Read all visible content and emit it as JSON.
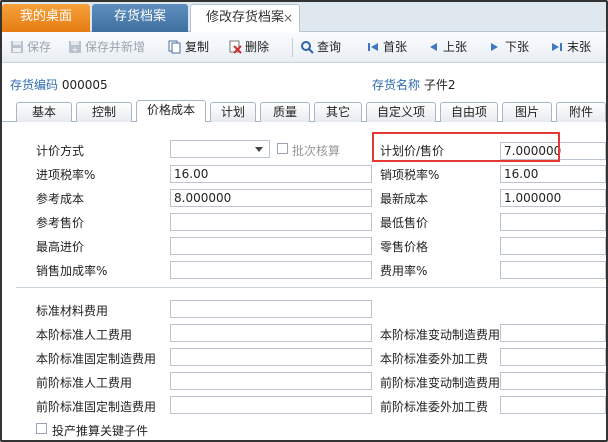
{
  "window_tabs": {
    "home": "我的桌面",
    "inventory": "存货档案",
    "edit": "修改存货档案",
    "close": "×"
  },
  "toolbar": {
    "save": "保存",
    "save_new": "保存并新增",
    "copy": "复制",
    "delete": "删除",
    "query": "查询",
    "first": "首张",
    "prev": "上张",
    "next": "下张",
    "last": "末张"
  },
  "header": {
    "code_label": "存货编码",
    "code_value": "000005",
    "name_label": "存货名称",
    "name_value": "子件2"
  },
  "tabs": [
    "基本",
    "控制",
    "价格成本",
    "计划",
    "质量",
    "其它",
    "自定义项",
    "自由项",
    "图片",
    "附件"
  ],
  "form": {
    "pricing_method_label": "计价方式",
    "pricing_method_value": "",
    "batch_check_label": "批次核算",
    "plan_price_label": "计划价/售价",
    "plan_price_value": "7.000000",
    "input_tax_label": "进项税率%",
    "input_tax_value": "16.00",
    "output_tax_label": "销项税率%",
    "output_tax_value": "16.00",
    "ref_cost_label": "参考成本",
    "ref_cost_value": "8.000000",
    "latest_cost_label": "最新成本",
    "latest_cost_value": "1.000000",
    "ref_price_label": "参考售价",
    "min_price_label": "最低售价",
    "max_purchase_label": "最高进价",
    "retail_price_label": "零售价格",
    "sales_markup_label": "销售加成率%",
    "expense_rate_label": "费用率%",
    "std_material_label": "标准材料费用",
    "this_labor_label": "本阶标准人工费用",
    "this_var_mfg_label": "本阶标准变动制造费用",
    "this_fixed_mfg_label": "本阶标准固定制造费用",
    "this_outsource_label": "本阶标准委外加工费",
    "prev_labor_label": "前阶标准人工费用",
    "prev_var_mfg_label": "前阶标准变动制造费用",
    "prev_fixed_mfg_label": "前阶标准固定制造费用",
    "prev_outsource_label": "前阶标准委外加工费",
    "key_child_label": "投产推算关键子件"
  },
  "colors": {
    "home_tab": "#f39a2e",
    "active_tab_blue": "#4a7aab",
    "highlight": "#e53935"
  }
}
